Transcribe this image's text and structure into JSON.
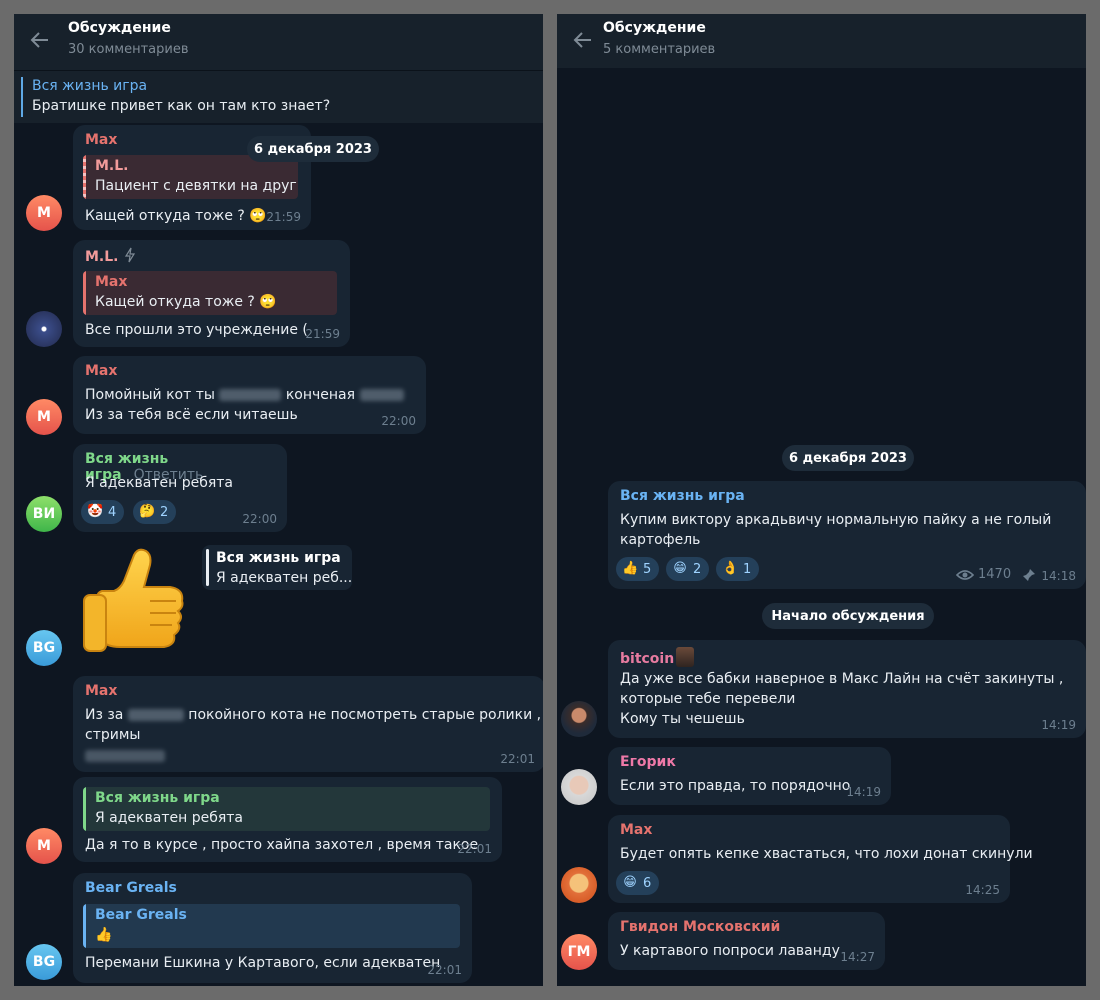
{
  "left": {
    "header": {
      "title": "Обсуждение",
      "subtitle": "30 комментариев"
    },
    "pinned": {
      "title": "Вся жизнь игра",
      "text": "Братишке привет как он там кто знает?"
    },
    "date_pill": "6 декабря 2023",
    "messages": [
      {
        "sender": "Max",
        "reply_name": "M.L.",
        "reply_text": "Пациент с девятки на друг...",
        "text": "Кащей откуда тоже ?",
        "time": "21:59",
        "avatar": "M"
      },
      {
        "sender": "M.L.",
        "reply_name": "Max",
        "reply_text": "Кащей откуда тоже ?",
        "text": "Все прошли это учреждение (",
        "time": "21:59"
      },
      {
        "sender": "Max",
        "line1_a": "Помойный кот ты",
        "line1_b": "конченая",
        "line2": "Из за тебя всё если читаешь",
        "time": "22:00",
        "avatar": "M"
      },
      {
        "sender": "Вся жизнь игра",
        "reply_action": "Ответить",
        "text": "Я адекватен ребята",
        "reactions": [
          {
            "emoji": "clown",
            "count": "4"
          },
          {
            "emoji": "thinking",
            "count": "2"
          }
        ],
        "time": "22:00",
        "avatar": "ВИ"
      },
      {
        "reply_name": "Вся жизнь игра",
        "reply_text": "Я адекватен реб...",
        "sticker": "thumbs-up",
        "avatar": "BG"
      },
      {
        "sender": "Max",
        "line1_a": "Из за",
        "line1_b": "покойного кота не посмотреть старые ролики ,",
        "line2": "стримы",
        "time": "22:01"
      },
      {
        "reply_name": "Вся жизнь игра",
        "reply_text": "Я адекватен ребята",
        "text": "Да я то в курсе , просто хайпа захотел , время такое",
        "time": "22:01",
        "avatar": "M"
      },
      {
        "sender": "Bear Greals",
        "reply_name": "Bear Greals",
        "reply_text": "👍",
        "text": "Перемани Ешкина у Картавого, если адекватен",
        "time": "22:01",
        "avatar": "BG"
      }
    ]
  },
  "right": {
    "header": {
      "title": "Обсуждение",
      "subtitle": "5 комментариев"
    },
    "date_pill": "6 декабря 2023",
    "post": {
      "sender": "Вся жизнь игра",
      "line1": "Купим виктору аркадьвичу нормальную пайку а не голый",
      "line2": "картофель",
      "reactions": [
        {
          "emoji": "thumbs-up",
          "count": "5"
        },
        {
          "emoji": "grinning",
          "count": "2"
        },
        {
          "emoji": "ok-hand",
          "count": "1"
        }
      ],
      "views": "1470",
      "time": "14:18"
    },
    "start_pill": "Начало обсуждения",
    "messages": [
      {
        "sender": "bitcoin",
        "line1": "Да уже все бабки наверное в Макс Лайн на счёт закинуты ,",
        "line2": "которые тебе перевели",
        "line3": "Кому ты чешешь",
        "time": "14:19"
      },
      {
        "sender": "Егорик",
        "text": "Если это правда, то порядочно",
        "time": "14:19"
      },
      {
        "sender": "Max",
        "text": "Будет опять кепке хвастаться, что лохи донат скинули",
        "reactions": [
          {
            "emoji": "grinning",
            "count": "6"
          }
        ],
        "time": "14:25"
      },
      {
        "sender": "Гвидон Московский",
        "text": "У картавого попроси лаванду",
        "time": "14:27",
        "avatar": "ГМ"
      }
    ]
  },
  "colors": {
    "max": "#e5736e",
    "ml": "#f29b9b",
    "channel": "#7fd88a",
    "blue_name": "#6ab3f3",
    "egorik": "#ee79a8",
    "bitcoin": "#e77ba0",
    "gvidon": "#e5736e"
  }
}
